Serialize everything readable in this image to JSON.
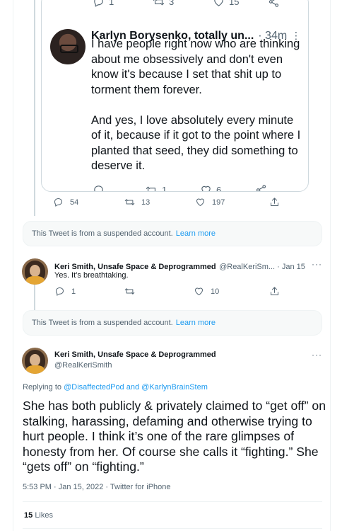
{
  "quoted_tweet": {
    "top_actions": {
      "reply_count": "1",
      "retweet_count": "3",
      "like_count": "15"
    },
    "author_name": "Karlyn Borysenko, totally un...",
    "time": "· 34m",
    "more": "⋮",
    "text": "I have people right now who are thinking about me obsessively and don't even know it's because I set that shit up to torment them forever.\n\nAnd yes, I love absolutely every minute of it, because if it got to the point where I planted that seed, they did something to deserve it.",
    "bottom_actions": {
      "retweet_count": "1",
      "like_count": "6"
    }
  },
  "outer_actions": {
    "reply_count": "54",
    "retweet_count": "13",
    "like_count": "197"
  },
  "suspended_1": {
    "text": "This Tweet is from a suspended account.",
    "link": "Learn more"
  },
  "reply_tweet": {
    "author_name": "Keri Smith, Unsafe Space & Deprogrammed",
    "handle_time": "@RealKeriSm... · Jan 15",
    "text": "Yes. It’s breathtaking.",
    "reply_count": "1",
    "like_count": "10"
  },
  "suspended_2": {
    "text": "This Tweet is from a suspended account.",
    "link": "Learn more"
  },
  "main_tweet": {
    "author_name": "Keri Smith, Unsafe Space & Deprogrammed",
    "handle": "@RealKeriSmith",
    "replying_prefix": "Replying to",
    "replying_user_1": "@DisaffectedPod",
    "replying_and": "and",
    "replying_user_2": "@KarlynBrainStem",
    "text": "She has both publicly & privately claimed to “get off” on stalking, harassing, defaming and otherwise trying to hurt people. I think it’s one of the rare glimpses of honesty from her. Of course she calls it “fighting.” She “gets off” on “fighting.”",
    "meta": "5:53 PM · Jan 15, 2022 · Twitter for iPhone",
    "likes_count": "15",
    "likes_label": "Likes"
  },
  "more_label": "···",
  "icons": [
    "reply-icon",
    "retweet-icon",
    "like-icon",
    "share-icon",
    "more-icon"
  ],
  "colors": {
    "link": "#1d9bf0",
    "muted": "#536471",
    "text": "#0f1419",
    "border": "#cfd9de",
    "suspended_bg": "#f7f9f9"
  }
}
